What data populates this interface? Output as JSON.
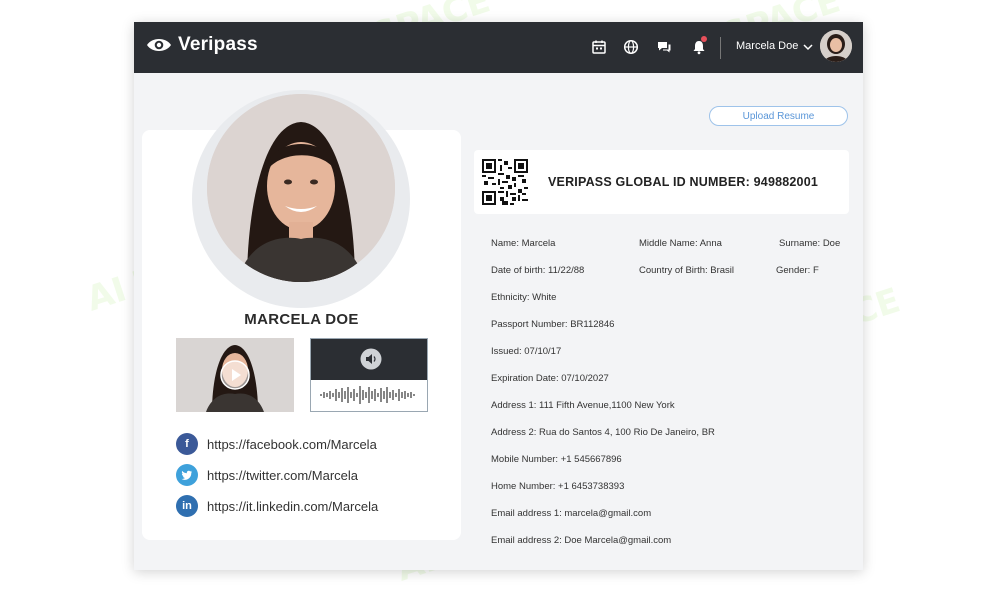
{
  "header": {
    "brand": "Veripass",
    "user_name": "Marcela Doe",
    "icons": [
      "calendar-icon",
      "globe-icon",
      "chat-icon",
      "bell-icon",
      "chevron-down-icon"
    ]
  },
  "actions": {
    "upload_resume": "Upload Resume"
  },
  "profile": {
    "name": "MARCELA DOE",
    "social": [
      {
        "network": "facebook",
        "icon_letter": "f",
        "color": "#3b5998",
        "url": "https://facebook.com/Marcela"
      },
      {
        "network": "twitter",
        "icon_letter": "t",
        "color": "#3ea1db",
        "url": "https://twitter.com/Marcela"
      },
      {
        "network": "linkedin",
        "icon_letter": "in",
        "color": "#2f6fb0",
        "url": "https://it.linkedin.com/Marcela"
      }
    ]
  },
  "id_card": {
    "label": "VERIPASS GLOBAL ID NUMBER: 949882001"
  },
  "details": {
    "name": "Name: Marcela",
    "middle_name": "Middle Name: Anna",
    "surname": "Surname: Doe",
    "dob": "Date of birth: 11/22/88",
    "country": "Country of Birth: Brasil",
    "gender": "Gender: F",
    "ethnicity": "Ethnicity: White",
    "passport": "Passport Number: BR112846",
    "issued": "Issued: 07/10/17",
    "expiration": "Expiration Date: 07/10/2027",
    "address1": "Address 1: 111 Fifth Avenue,1100 New York",
    "address2": "Address 2: Rua do Santos 4, 100 Rio De Janeiro, BR",
    "mobile": "Mobile Number: +1 545667896",
    "home": "Home Number: +1 6453738393",
    "email1": "Email address 1: marcela@gmail.com",
    "email2": "Email address 2: Doe Marcela@gmail.com"
  },
  "watermark": "AI TALENT SPACE",
  "colors": {
    "topbar": "#2b2e33",
    "accent": "#5a96d8",
    "background": "#f3f4f6"
  }
}
